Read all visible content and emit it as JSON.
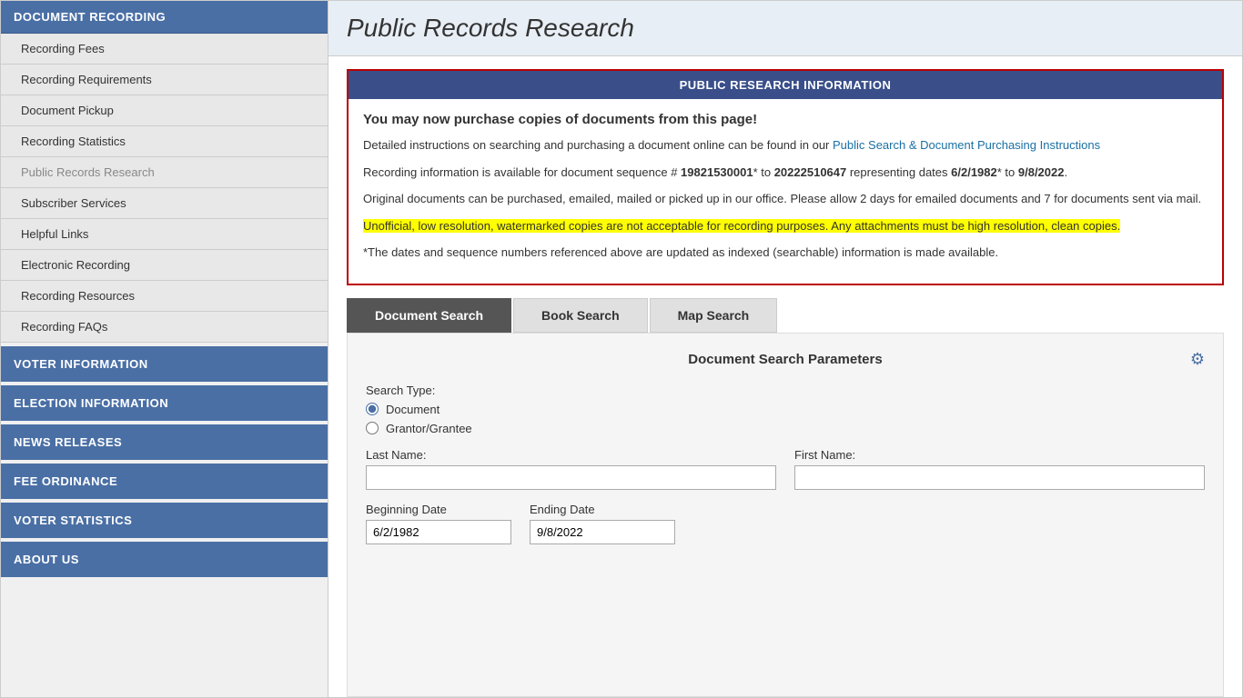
{
  "sidebar": {
    "doc_recording_header": "DOCUMENT RECORDING",
    "nav_items": [
      {
        "label": "Recording Fees",
        "active": false
      },
      {
        "label": "Recording Requirements",
        "active": false
      },
      {
        "label": "Document Pickup",
        "active": false
      },
      {
        "label": "Recording Statistics",
        "active": false
      },
      {
        "label": "Public Records Research",
        "active": true
      },
      {
        "label": "Subscriber Services",
        "active": false
      },
      {
        "label": "Helpful Links",
        "active": false
      },
      {
        "label": "Electronic Recording",
        "active": false
      },
      {
        "label": "Recording Resources",
        "active": false
      },
      {
        "label": "Recording FAQs",
        "active": false
      }
    ],
    "collapsed_sections": [
      "VOTER INFORMATION",
      "ELECTION INFORMATION",
      "NEWS RELEASES",
      "FEE ORDINANCE",
      "VOTER STATISTICS",
      "ABOUT US"
    ]
  },
  "page_title": "Public Records Research",
  "info_box": {
    "header": "PUBLIC RESEARCH INFORMATION",
    "headline": "You may now purchase copies of documents from this page!",
    "line1_prefix": "Detailed instructions on searching and purchasing a document online can be found in our ",
    "line1_link": "Public Search & Document Purchasing Instructions",
    "line2": "Recording information is available for document sequence # 19821530001* to 20222510647 representing dates 6/2/1982* to 9/8/2022.",
    "line2_bold1": "19821530001",
    "line2_bold2": "20222510647",
    "line2_bold3": "6/2/1982",
    "line2_bold4": "9/8/2022",
    "line3": "Original documents can be purchased, emailed, mailed or picked up in our office. Please allow 2 days for emailed documents and 7 for documents sent via mail.",
    "line4_highlight": "Unofficial, low resolution, watermarked copies are not acceptable for recording purposes. Any attachments must be high resolution, clean copies.",
    "line5": "*The dates and sequence numbers referenced above are updated as indexed (searchable) information is made available."
  },
  "tabs": [
    {
      "label": "Document Search",
      "active": true
    },
    {
      "label": "Book Search",
      "active": false
    },
    {
      "label": "Map Search",
      "active": false
    }
  ],
  "search_panel": {
    "title": "Document Search Parameters",
    "gear_icon": "⚙",
    "search_type_label": "Search Type:",
    "radio_options": [
      {
        "label": "Document",
        "checked": true
      },
      {
        "label": "Grantor/Grantee",
        "checked": false
      }
    ],
    "last_name_label": "Last Name:",
    "first_name_label": "First Name:",
    "last_name_placeholder": "",
    "first_name_placeholder": "",
    "beginning_date_label": "Beginning Date",
    "ending_date_label": "Ending Date",
    "beginning_date_value": "6/2/1982",
    "ending_date_value": "9/8/2022"
  }
}
